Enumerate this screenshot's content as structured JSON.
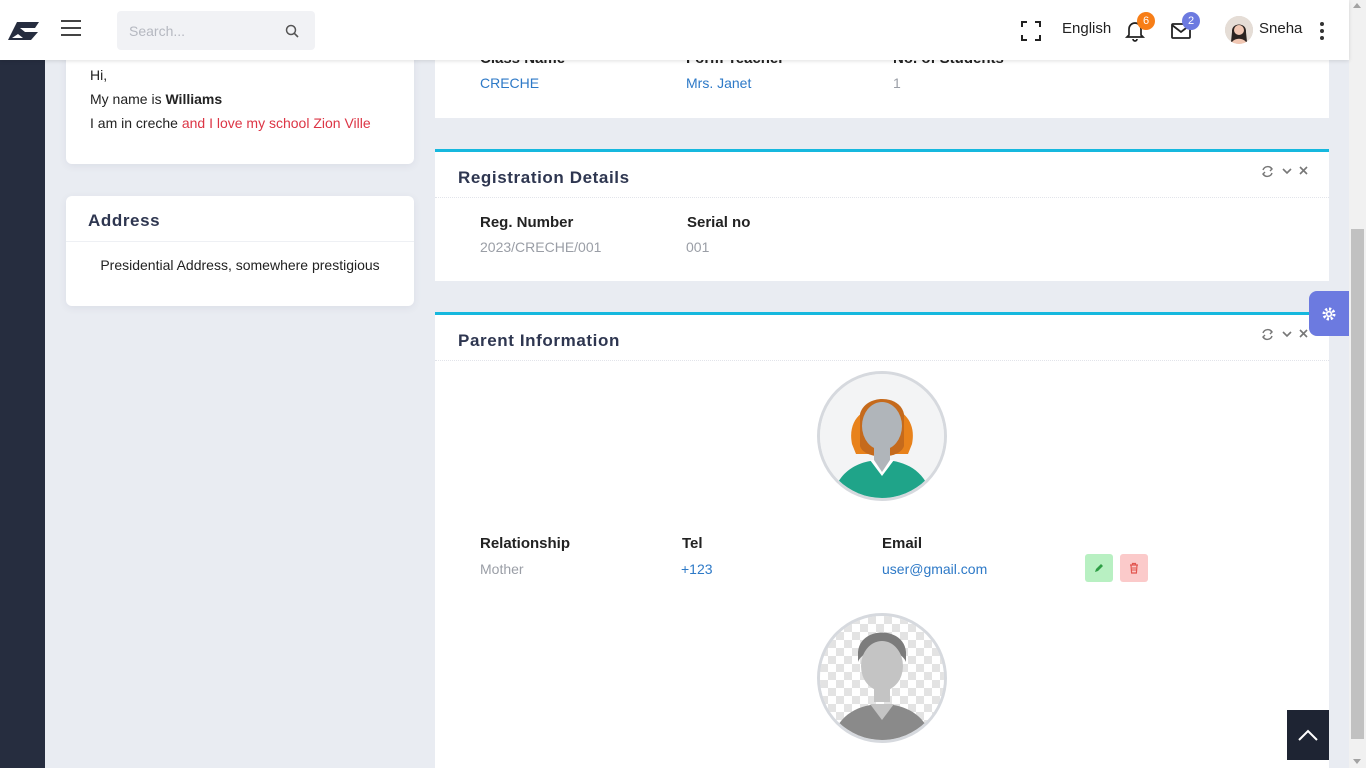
{
  "header": {
    "search_placeholder": "Search...",
    "language": "English",
    "notifications_count": "6",
    "messages_count": "2",
    "user_name": "Sneha"
  },
  "class_info": {
    "class_name_label": "Class Name",
    "form_teacher_label": "Form Teacher",
    "students_label": "No. of Students",
    "class_name": "CRECHE",
    "form_teacher": "Mrs. Janet",
    "students": "1"
  },
  "about": {
    "greeting": "Hi,",
    "name_prefix": "My name is ",
    "name": "Williams",
    "class_text": "I am in creche ",
    "highlight": "and I love my school Zion Ville"
  },
  "address": {
    "title": "Address",
    "text": "Presidential Address, somewhere prestigious"
  },
  "registration": {
    "title": "Registration Details",
    "reg_label": "Reg. Number",
    "reg_value": "2023/CRECHE/001",
    "serial_label": "Serial no",
    "serial_value": "001"
  },
  "parent": {
    "title": "Parent Information",
    "relationship_label": "Relationship",
    "tel_label": "Tel",
    "email_label": "Email",
    "relationship": "Mother",
    "tel": "+123",
    "email": "user@gmail.com"
  },
  "colors": {
    "accent": "#16b8de",
    "sidebar": "#262d3f",
    "settings_tab": "#6c7ae0",
    "link": "#2d79c7",
    "highlight_text": "#dc3545"
  },
  "icons": [
    "logo-icon",
    "menu-icon",
    "search-icon",
    "fullscreen-icon",
    "bell-icon",
    "mail-icon",
    "more-vertical-icon",
    "refresh-icon",
    "chevron-down-icon",
    "close-icon",
    "pencil-icon",
    "trash-icon",
    "gear-icon",
    "chevron-up-icon"
  ]
}
